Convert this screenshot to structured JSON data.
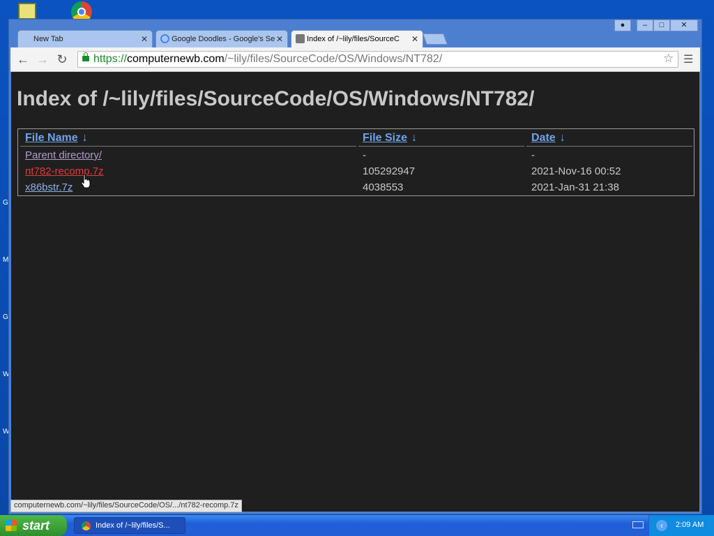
{
  "desktop": {
    "edge_labels": [
      "G",
      "M",
      "G",
      "W",
      "W"
    ]
  },
  "tabs": [
    {
      "title": "New Tab",
      "icon": "none"
    },
    {
      "title": "Google Doodles - Google's Se",
      "icon": "google-icon"
    },
    {
      "title": "Index of /~lily/files/SourceC",
      "icon": "page-icon"
    }
  ],
  "addressbar": {
    "scheme": "https://",
    "host": "computernewb.com",
    "path": "/~lily/files/SourceCode/OS/Windows/NT782/"
  },
  "page": {
    "heading": "Index of /~lily/files/SourceCode/OS/Windows/NT782/",
    "columns": {
      "name": "File Name",
      "size": "File Size",
      "date": "Date",
      "sort_glyph": "↓"
    },
    "rows": [
      {
        "name": "Parent directory/",
        "size": "-",
        "date": "-"
      },
      {
        "name": "nt782-recomp.7z",
        "size": "105292947",
        "date": "2021-Nov-16 00:52"
      },
      {
        "name": "x86bstr.7z",
        "size": "4038553",
        "date": "2021-Jan-31 21:38"
      }
    ]
  },
  "status_url": "computernewb.com/~lily/files/SourceCode/OS/.../nt782-recomp.7z",
  "taskbar": {
    "start_label": "start",
    "task_title": "Index of /~lily/files/S...",
    "clock": "2:09 AM"
  },
  "colors": {
    "page_bg": "#1f1f1f",
    "link": "#8cb0e6",
    "hover_link": "#e03b3b",
    "header": "#6fa4ea"
  }
}
